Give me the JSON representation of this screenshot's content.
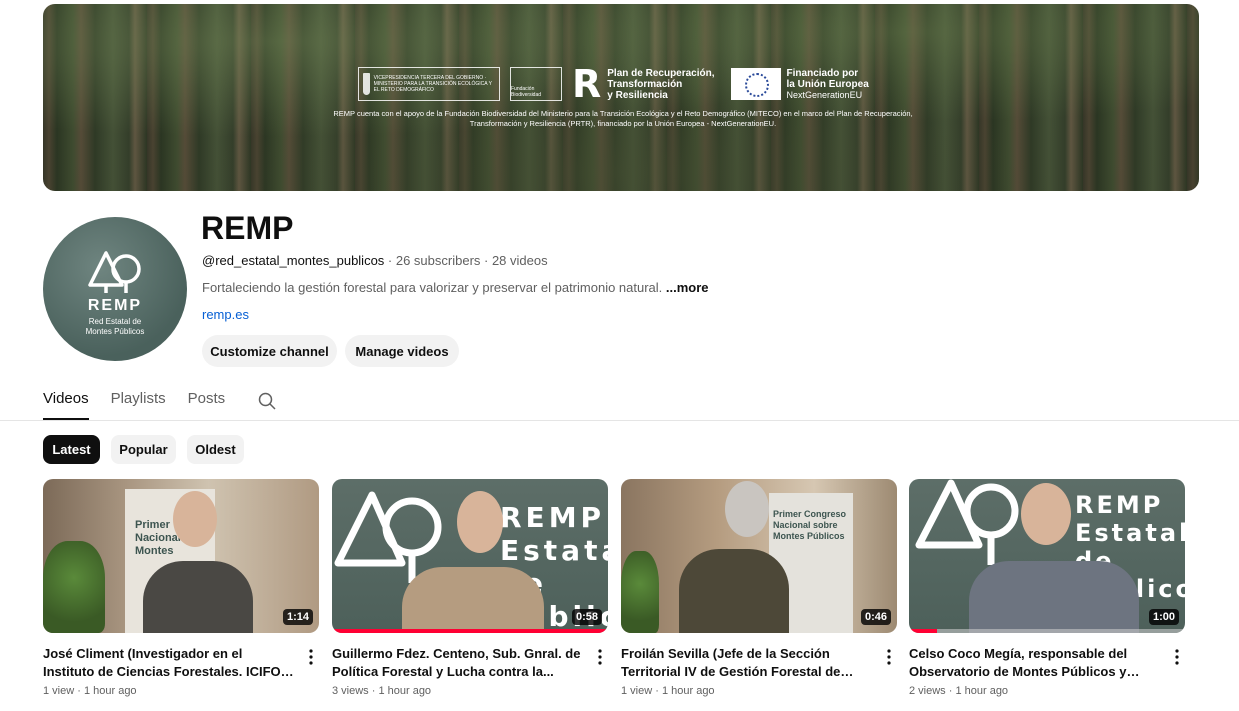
{
  "banner": {
    "gov_text": "VICEPRESIDENCIA TERCERA DEL GOBIERNO · MINISTERIO PARA LA TRANSICIÓN ECOLÓGICA Y EL RETO DEMOGRÁFICO",
    "gov_crest": "GOBIERNO DE ESPAÑA",
    "foundation": "Fundación Biodiversidad",
    "prtr_line1": "Plan de Recuperación,",
    "prtr_line2": "Transformación",
    "prtr_line3": "y Resiliencia",
    "eu_line1": "Financiado por",
    "eu_line2": "la Unión Europea",
    "eu_line3": "NextGenerationEU",
    "disclaimer": "REMP cuenta con el apoyo de la Fundación Biodiversidad del Ministerio para la Transición Ecológica y el Reto Demográfico (MITECO) en el marco del Plan de Recuperación, Transformación y Resiliencia (PRTR), financiado por la Unión Europea - NextGenerationEU."
  },
  "avatar": {
    "name": "REMP",
    "sub1": "Red Estatal de",
    "sub2": "Montes Públicos"
  },
  "channel": {
    "title": "REMP",
    "handle": "@red_estatal_montes_publicos",
    "stats": " · 26 subscribers · 28 videos",
    "description": "Fortaleciendo la gestión forestal para valorizar y preservar el patrimonio natural. ",
    "more": "...more",
    "link": "remp.es",
    "customize_label": "Customize channel",
    "manage_label": "Manage videos"
  },
  "tabs": [
    {
      "label": "Videos",
      "active": true
    },
    {
      "label": "Playlists",
      "active": false
    },
    {
      "label": "Posts",
      "active": false
    }
  ],
  "chips": [
    {
      "label": "Latest",
      "active": true
    },
    {
      "label": "Popular",
      "active": false
    },
    {
      "label": "Oldest",
      "active": false
    }
  ],
  "videos": [
    {
      "title": "José Climent (Investigador en el Instituto de Ciencias Forestales. ICIFOR-INIA, CSIC)",
      "meta": "1 view · 1 hour ago",
      "duration": "1:14",
      "thumb_text": "Primer Nacional Montes",
      "watched_fraction": 0
    },
    {
      "title": "Guillermo Fdez. Centeno, Sub. Gnral. de Política Forestal y Lucha contra la...",
      "meta": "3 views · 1 hour ago",
      "duration": "0:58",
      "thumb_text": "REMP Estatal de Públicos",
      "watched_fraction": 1
    },
    {
      "title": "Froilán Sevilla (Jefe de la Sección Territorial IV de Gestión Forestal de Burgos de la JCyL)",
      "meta": "1 view · 1 hour ago",
      "duration": "0:46",
      "thumb_text": "Primer Congreso Nacional sobre Montes Públicos",
      "watched_fraction": 0
    },
    {
      "title": "Celso Coco Megía, responsable del Observatorio de Montes Públicos y técnico...",
      "meta": "2 views · 1 hour ago",
      "duration": "1:00",
      "thumb_text": "REMP Estatal de Públicos",
      "watched_fraction": 0.1
    }
  ],
  "colors": {
    "accent_red": "#ff0033",
    "link_blue": "#065fd4",
    "chip_active": "#0f0f0f",
    "avatar_bg": "#4a615c"
  }
}
